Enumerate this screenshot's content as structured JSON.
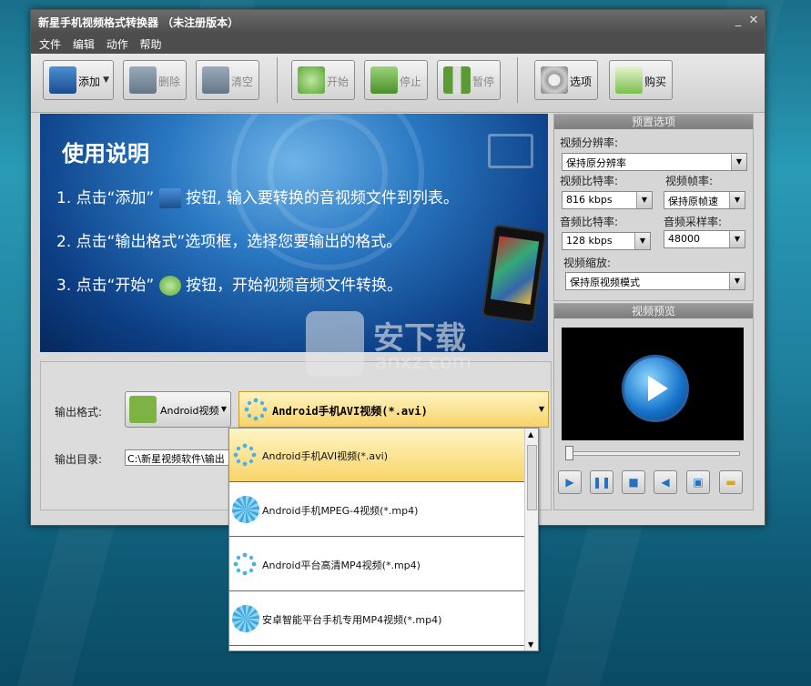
{
  "window": {
    "title": "新星手机视频格式转换器 （未注册版本）"
  },
  "menu": [
    "文件",
    "编辑",
    "动作",
    "帮助"
  ],
  "toolbar": {
    "add": "添加",
    "delete": "删除",
    "clear": "清空",
    "start": "开始",
    "stop": "停止",
    "pause": "暂停",
    "options": "选项",
    "buy": "购买"
  },
  "banner": {
    "title": "使用说明",
    "step1a": "1. 点击“添加”",
    "step1b": "按钮, 输入要转换的音视频文件到列表。",
    "step2": "2. 点击“输出格式”选项框，选择您要输出的格式。",
    "step3a": "3. 点击“开始”",
    "step3b": "按钮，开始视频音频文件转换。"
  },
  "output": {
    "format_label": "输出格式:",
    "format_category": "Android视频",
    "format_value": "Android手机AVI视频(*.avi)",
    "dir_label": "输出目录:",
    "dir_value": "C:\\新星视频软件\\输出"
  },
  "presets": {
    "header": "预置选项",
    "video_res_label": "视频分辨率:",
    "video_res": "保持原分辨率",
    "video_bitrate_label": "视频比特率:",
    "video_bitrate": "816 kbps",
    "video_fps_label": "视频帧率:",
    "video_fps": "保持原帧速",
    "audio_bitrate_label": "音频比特率:",
    "audio_bitrate": "128 kbps",
    "audio_rate_label": "音频采样率:",
    "audio_rate": "48000",
    "scale_label": "视频缩放:",
    "scale": "保持原视频模式"
  },
  "preview": {
    "header": "视频预览"
  },
  "dropdown": {
    "items": [
      "Android手机AVI视频(*.avi)",
      "Android手机MPEG-4视频(*.mp4)",
      "Android平台高清MP4视频(*.mp4)",
      "安卓智能平台手机专用MP4视频(*.mp4)"
    ]
  },
  "watermark": {
    "text1": "安下载",
    "text2": "anxz.com"
  }
}
